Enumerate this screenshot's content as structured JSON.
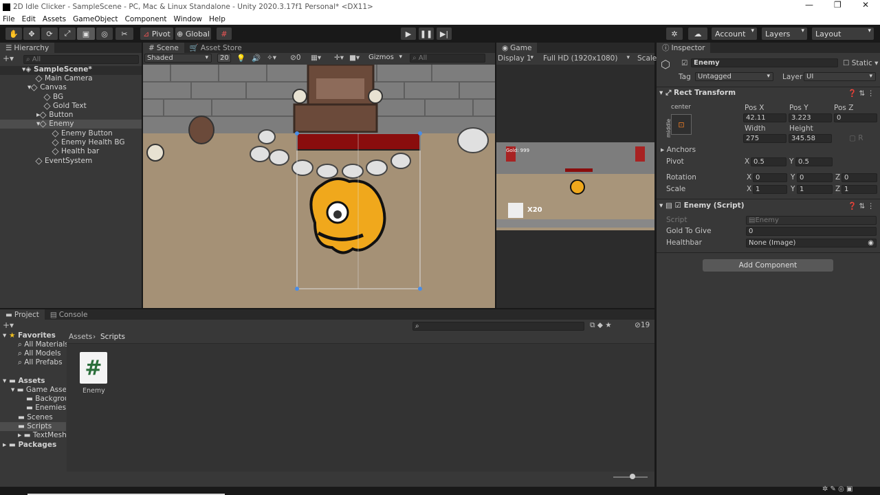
{
  "window": {
    "title": "2D Idle Clicker - SampleScene - PC, Mac & Linux Standalone - Unity 2020.3.17f1 Personal* <DX11>"
  },
  "menu": [
    "File",
    "Edit",
    "Assets",
    "GameObject",
    "Component",
    "Window",
    "Help"
  ],
  "toolbar": {
    "pivot": "Pivot",
    "global": "Global",
    "account": "Account",
    "layers": "Layers",
    "layout": "Layout"
  },
  "hierarchy": {
    "tab": "Hierarchy",
    "search": "All",
    "items": [
      "SampleScene*",
      "Main Camera",
      "Canvas",
      "BG",
      "Gold Text",
      "Button",
      "Enemy",
      "Enemy Button",
      "Enemy Health BG",
      "Health bar",
      "EventSystem"
    ]
  },
  "scene": {
    "tab": "Scene",
    "tab2": "Asset Store",
    "shading": "Shaded",
    "value": "20",
    "hidden_count": "0",
    "gizmos": "Gizmos",
    "search": "All"
  },
  "game": {
    "tab": "Game",
    "display": "Display 1",
    "resolution": "Full HD (1920x1080)",
    "scale": "Scale",
    "gold_label": "Gold: 999",
    "multiplier": "X20"
  },
  "inspector": {
    "tab": "Inspector",
    "object": "Enemy",
    "static": "Static",
    "tag_label": "Tag",
    "tag": "Untagged",
    "layer_label": "Layer",
    "layer": "UI",
    "rect": {
      "title": "Rect Transform",
      "anchor_h": "center",
      "anchor_v": "middle",
      "posx_l": "Pos X",
      "posy_l": "Pos Y",
      "posz_l": "Pos Z",
      "posx": "42.11",
      "posy": "3.223",
      "posz": "0",
      "w_l": "Width",
      "h_l": "Height",
      "w": "275",
      "h": "345.58",
      "anchors": "Anchors",
      "pivot": "Pivot",
      "px": "0.5",
      "py": "0.5",
      "rotation": "Rotation",
      "rx": "0",
      "ry": "0",
      "rz": "0",
      "scale": "Scale",
      "sx": "1",
      "sy": "1",
      "sz": "1",
      "x": "X",
      "y": "Y",
      "z": "Z"
    },
    "script": {
      "title": "Enemy (Script)",
      "script_l": "Script",
      "script_v": "Enemy",
      "gold_l": "Gold To Give",
      "gold_v": "0",
      "hb_l": "Healthbar",
      "hb_v": "None (Image)"
    },
    "add": "Add Component"
  },
  "project": {
    "tab": "Project",
    "tab2": "Console",
    "count": "19",
    "breadcrumb1": "Assets",
    "breadcrumb2": "Scripts",
    "favorites": "Favorites",
    "fav_items": [
      "All Materials",
      "All Models",
      "All Prefabs"
    ],
    "assets": "Assets",
    "asset_items": [
      "Game Assets",
      "Backgrou",
      "Enemies",
      "Scenes",
      "Scripts",
      "TextMesh P"
    ],
    "packages": "Packages",
    "file_name": "Enemy",
    "file_glyph": "#"
  }
}
